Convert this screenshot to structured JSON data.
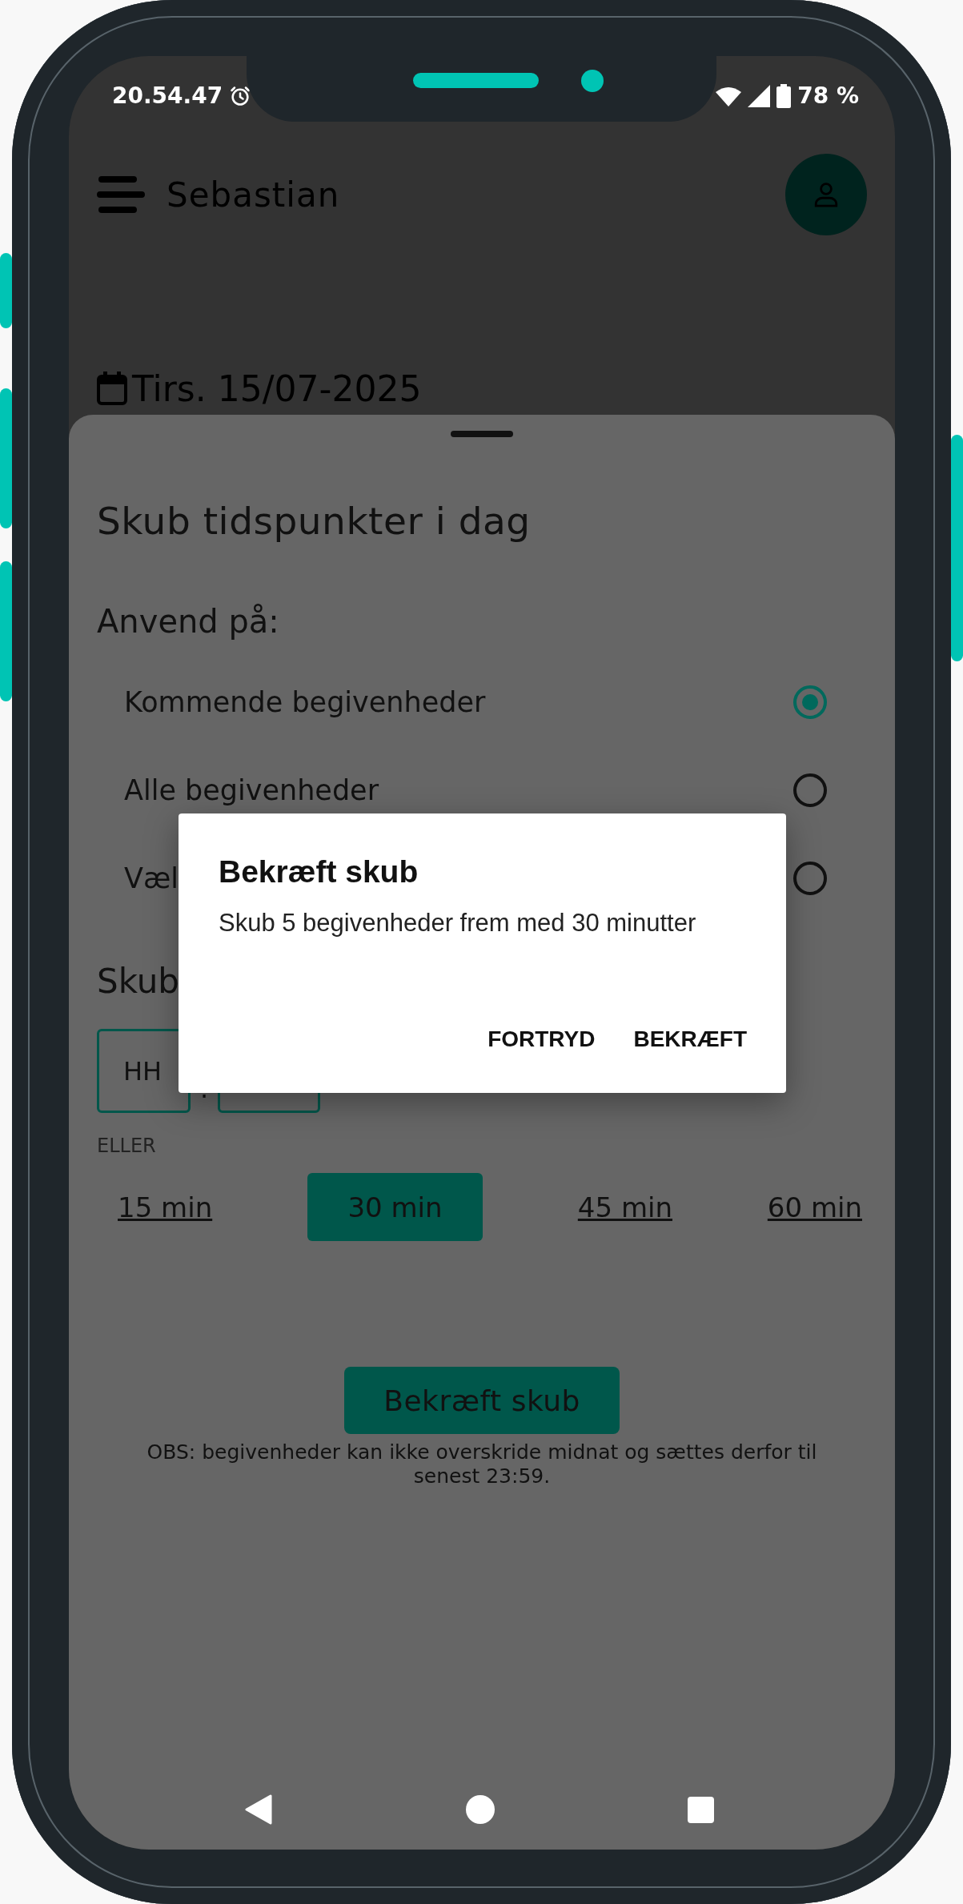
{
  "status_bar": {
    "time": "20.54.47",
    "battery": "78 %"
  },
  "header": {
    "user_name": "Sebastian"
  },
  "date": "Tirs. 15/07-2025",
  "sheet": {
    "title": "Skub tidspunkter i dag",
    "apply_label": "Anvend på:",
    "options": [
      {
        "label": "Kommende begivenheder",
        "selected": true
      },
      {
        "label": "Alle begivenheder",
        "selected": false
      },
      {
        "label": "Væl",
        "selected": false
      }
    ],
    "shift_label": "Skub",
    "hours_placeholder": "HH",
    "separator": ".",
    "or_label": "ELLER",
    "presets": [
      {
        "label": "15 min",
        "selected": false
      },
      {
        "label": "30 min",
        "selected": true
      },
      {
        "label": "45 min",
        "selected": false
      },
      {
        "label": "60 min",
        "selected": false
      }
    ],
    "confirm_button": "Bekræft skub",
    "note": "OBS: begivenheder kan ikke overskride midnat og sættes derfor til senest 23:59."
  },
  "dialog": {
    "title": "Bekræft skub",
    "message": "Skub 5 begivenheder frem med 30 minutter",
    "buttons": [
      "FORTRYD",
      "BEKRÆFT"
    ]
  }
}
